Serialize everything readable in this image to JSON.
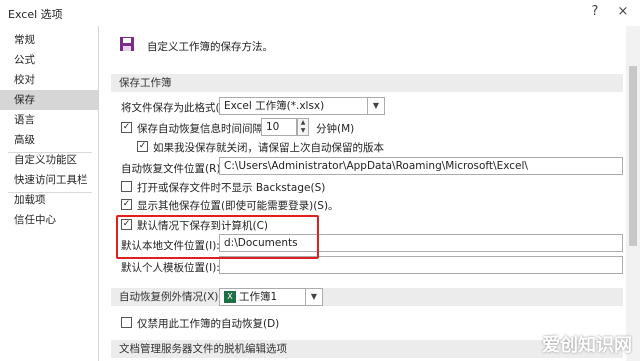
{
  "window": {
    "title": "Excel 选项",
    "help": "?",
    "close": "×"
  },
  "sidebar": {
    "items": [
      {
        "label": "常规"
      },
      {
        "label": "公式"
      },
      {
        "label": "校对"
      },
      {
        "label": "保存",
        "active": true
      },
      {
        "label": "语言"
      },
      {
        "label": "高级"
      },
      {
        "label": "自定义功能区"
      },
      {
        "label": "快速访问工具栏"
      },
      {
        "label": "加载项"
      },
      {
        "label": "信任中心"
      }
    ]
  },
  "main": {
    "heading": "自定义工作簿的保存方法。",
    "save_section": {
      "header": "保存工作簿",
      "format_label": "将文件保存为此格式(F):",
      "format_value": "Excel 工作簿(*.xlsx)",
      "autorecover_label": "保存自动恢复信息时间间隔(A)",
      "autorecover_checked": true,
      "autorecover_minutes": "10",
      "minutes_label": "分钟(M)",
      "keep_last_label": "如果我没保存就关闭，请保留上次自动保留的版本",
      "keep_last_checked": true,
      "recover_location_label": "自动恢复文件位置(R):",
      "recover_location_value": "C:\\Users\\Administrator\\AppData\\Roaming\\Microsoft\\Excel\\",
      "no_backstage_label": "打开或保存文件时不显示 Backstage(S)",
      "no_backstage_checked": false,
      "show_additional_label": "显示其他保存位置(即使可能需要登录)(S)。",
      "show_additional_checked": true,
      "default_computer_label": "默认情况下保存到计算机(C)",
      "default_computer_checked": true,
      "default_local_label": "默认本地文件位置(I):",
      "default_local_value": "d:\\Documents",
      "personal_template_label": "默认个人模板位置(I):",
      "personal_template_value": ""
    },
    "autorecover_exceptions": {
      "label": "自动恢复例外情况(X):",
      "workbook_value": "工作簿1",
      "disable_label": "仅禁用此工作簿的自动恢复(D)",
      "disable_checked": false
    },
    "offline_section": {
      "header": "文档管理服务器文件的脱机编辑选项"
    }
  },
  "watermark": "爱创知识网",
  "colors": {
    "highlight_border": "#e21f1f",
    "active_sidebar": "#d6d6d6",
    "excel_green": "#1d7044"
  }
}
